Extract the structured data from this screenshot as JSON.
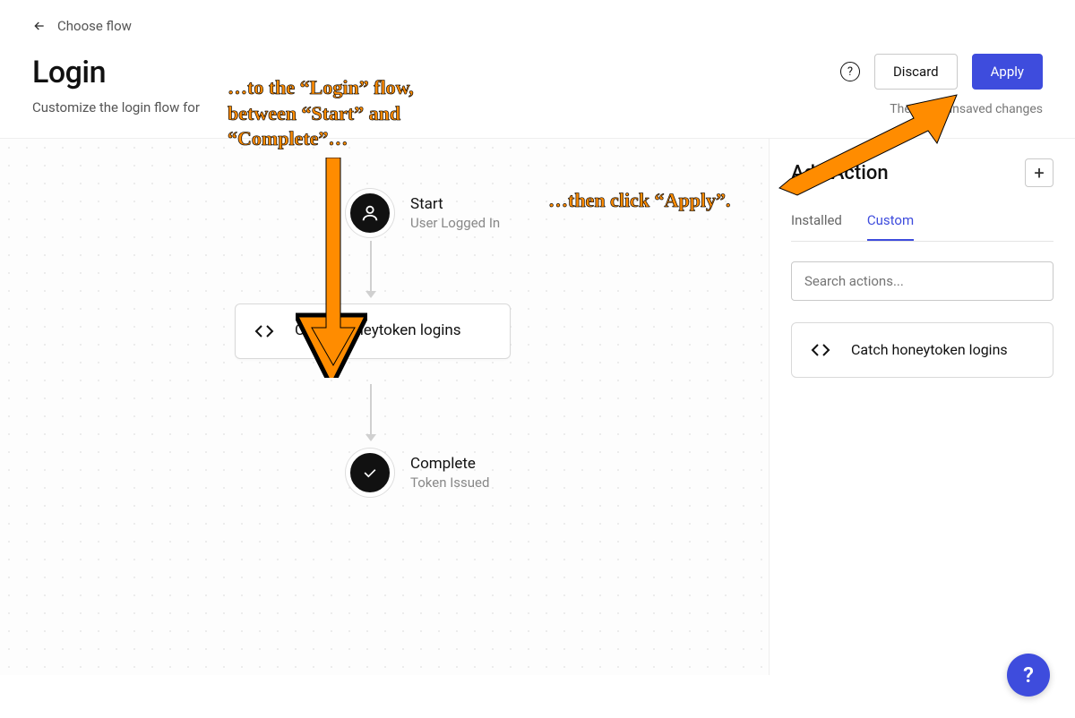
{
  "breadcrumb": {
    "label": "Choose flow"
  },
  "header": {
    "title": "Login",
    "subtitle": "Customize the login flow for",
    "help_icon": "?",
    "discard_label": "Discard",
    "apply_label": "Apply",
    "unsaved_message": "There are unsaved changes"
  },
  "flow": {
    "start": {
      "title": "Start",
      "subtitle": "User Logged In"
    },
    "action": {
      "title": "Catch honeytoken logins",
      "icon": "code-icon"
    },
    "complete": {
      "title": "Complete",
      "subtitle": "Token Issued"
    }
  },
  "sidebar": {
    "title": "Add Action",
    "add_icon": "+",
    "tabs": {
      "installed": "Installed",
      "custom": "Custom"
    },
    "search_placeholder": "Search actions...",
    "actions": [
      {
        "label": "Catch honeytoken logins",
        "icon": "code-icon"
      }
    ]
  },
  "floating_help": "?",
  "annotations": {
    "a1_line1": "…to the “Login” flow,",
    "a1_line2": "between “Start” and",
    "a1_line3": "“Complete”…",
    "a2": "…then click “Apply”."
  }
}
